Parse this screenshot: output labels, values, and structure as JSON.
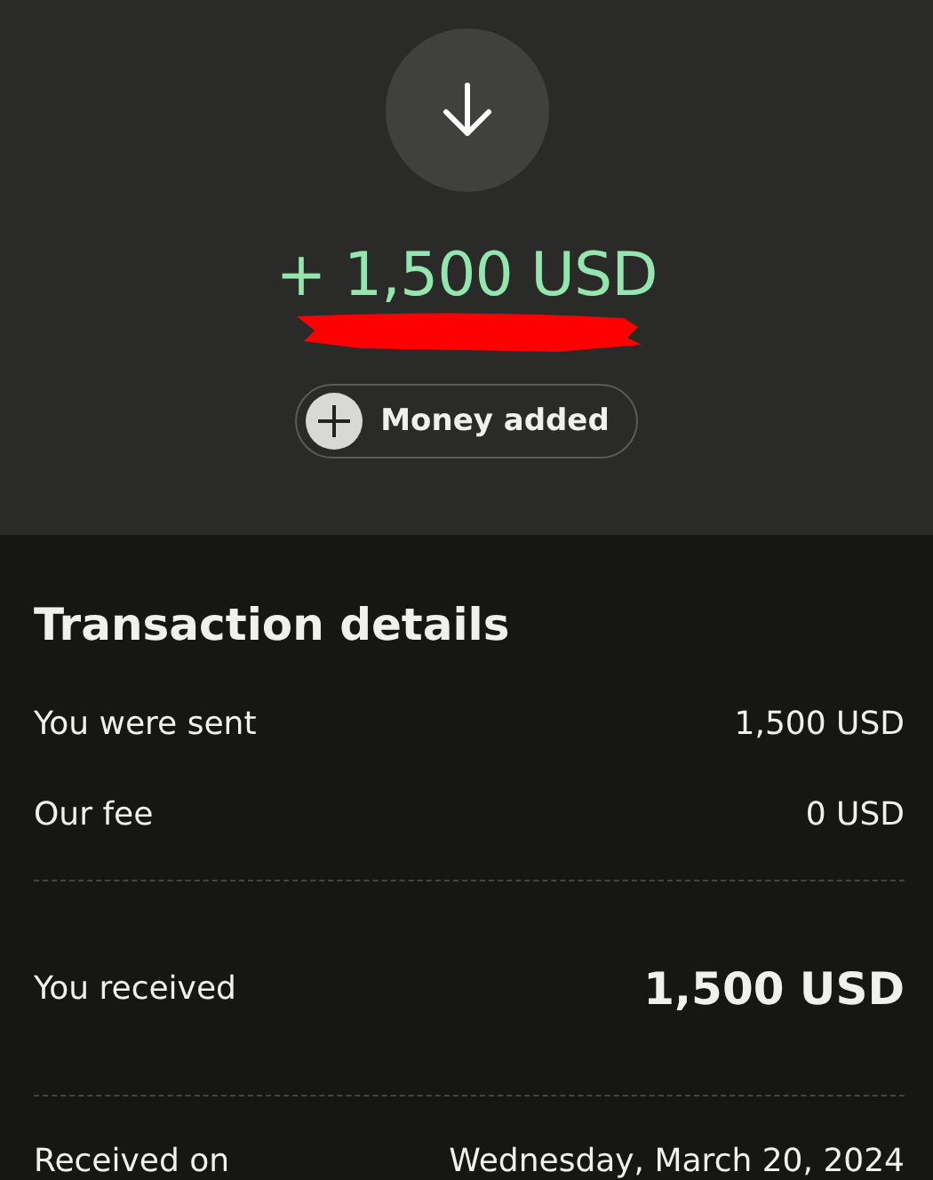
{
  "header": {
    "amount": "+ 1,500 USD",
    "status_chip": {
      "label": "Money added"
    }
  },
  "details": {
    "title": "Transaction details",
    "groups": [
      [
        {
          "label": "You were sent",
          "value": "1,500 USD",
          "kind": "regular"
        },
        {
          "label": "Our fee",
          "value": "0 USD",
          "kind": "regular"
        }
      ],
      [
        {
          "label": "You received",
          "value": "1,500 USD",
          "kind": "total"
        }
      ],
      [
        {
          "label": "Received on",
          "value": "Wednesday, March 20, 2024",
          "kind": "regular"
        }
      ]
    ]
  }
}
